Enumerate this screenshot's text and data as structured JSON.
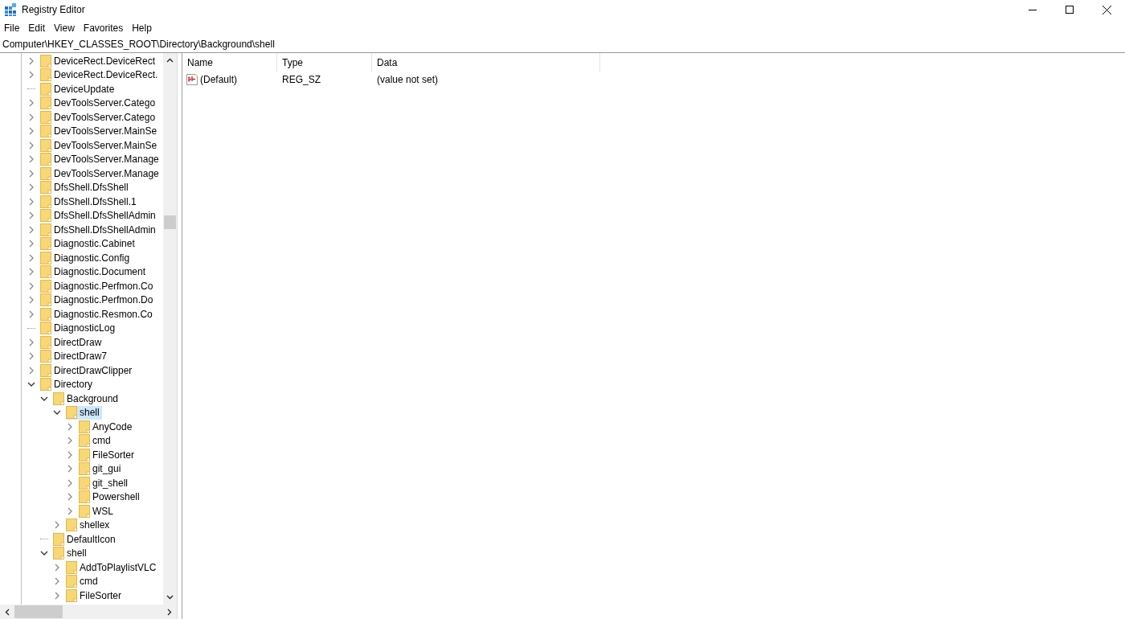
{
  "window": {
    "title": "Registry Editor"
  },
  "menu": [
    "File",
    "Edit",
    "View",
    "Favorites",
    "Help"
  ],
  "address": "Computer\\HKEY_CLASSES_ROOT\\Directory\\Background\\shell",
  "tree": [
    {
      "label": "DeviceRect.DeviceRect",
      "expandable": true,
      "expanded": false,
      "selected": false
    },
    {
      "label": "DeviceRect.DeviceRect.",
      "expandable": true,
      "expanded": false,
      "selected": false
    },
    {
      "label": "DeviceUpdate",
      "expandable": false,
      "selected": false
    },
    {
      "label": "DevToolsServer.Catego",
      "expandable": true,
      "expanded": false,
      "selected": false
    },
    {
      "label": "DevToolsServer.Catego",
      "expandable": true,
      "expanded": false,
      "selected": false
    },
    {
      "label": "DevToolsServer.MainSe",
      "expandable": true,
      "expanded": false,
      "selected": false
    },
    {
      "label": "DevToolsServer.MainSe",
      "expandable": true,
      "expanded": false,
      "selected": false
    },
    {
      "label": "DevToolsServer.Manage",
      "expandable": true,
      "expanded": false,
      "selected": false
    },
    {
      "label": "DevToolsServer.Manage",
      "expandable": true,
      "expanded": false,
      "selected": false
    },
    {
      "label": "DfsShell.DfsShell",
      "expandable": true,
      "expanded": false,
      "selected": false
    },
    {
      "label": "DfsShell.DfsShell.1",
      "expandable": true,
      "expanded": false,
      "selected": false
    },
    {
      "label": "DfsShell.DfsShellAdmin",
      "expandable": true,
      "expanded": false,
      "selected": false
    },
    {
      "label": "DfsShell.DfsShellAdmin",
      "expandable": true,
      "expanded": false,
      "selected": false
    },
    {
      "label": "Diagnostic.Cabinet",
      "expandable": true,
      "expanded": false,
      "selected": false
    },
    {
      "label": "Diagnostic.Config",
      "expandable": true,
      "expanded": false,
      "selected": false
    },
    {
      "label": "Diagnostic.Document",
      "expandable": true,
      "expanded": false,
      "selected": false
    },
    {
      "label": "Diagnostic.Perfmon.Co",
      "expandable": true,
      "expanded": false,
      "selected": false
    },
    {
      "label": "Diagnostic.Perfmon.Do",
      "expandable": true,
      "expanded": false,
      "selected": false
    },
    {
      "label": "Diagnostic.Resmon.Co",
      "expandable": true,
      "expanded": false,
      "selected": false
    },
    {
      "label": "DiagnosticLog",
      "expandable": false,
      "selected": false
    },
    {
      "label": "DirectDraw",
      "expandable": true,
      "expanded": false,
      "selected": false
    },
    {
      "label": "DirectDraw7",
      "expandable": true,
      "expanded": false,
      "selected": false
    },
    {
      "label": "DirectDrawClipper",
      "expandable": true,
      "expanded": false,
      "selected": false
    },
    {
      "label": "Directory",
      "expandable": true,
      "expanded": true,
      "selected": false,
      "children": [
        {
          "label": "Background",
          "expandable": true,
          "expanded": true,
          "selected": false,
          "children": [
            {
              "label": "shell",
              "expandable": true,
              "expanded": true,
              "selected": true,
              "children": [
                {
                  "label": "AnyCode",
                  "expandable": true,
                  "expanded": false,
                  "selected": false
                },
                {
                  "label": "cmd",
                  "expandable": true,
                  "expanded": false,
                  "selected": false
                },
                {
                  "label": "FileSorter",
                  "expandable": true,
                  "expanded": false,
                  "selected": false
                },
                {
                  "label": "git_gui",
                  "expandable": true,
                  "expanded": false,
                  "selected": false
                },
                {
                  "label": "git_shell",
                  "expandable": true,
                  "expanded": false,
                  "selected": false
                },
                {
                  "label": "Powershell",
                  "expandable": true,
                  "expanded": false,
                  "selected": false
                },
                {
                  "label": "WSL",
                  "expandable": true,
                  "expanded": false,
                  "selected": false
                }
              ]
            },
            {
              "label": "shellex",
              "expandable": true,
              "expanded": false,
              "selected": false
            }
          ]
        },
        {
          "label": "DefaultIcon",
          "expandable": false,
          "selected": false
        },
        {
          "label": "shell",
          "expandable": true,
          "expanded": true,
          "selected": false,
          "children": [
            {
              "label": "AddToPlaylistVLC",
              "expandable": true,
              "expanded": false,
              "selected": false
            },
            {
              "label": "cmd",
              "expandable": true,
              "expanded": false,
              "selected": false
            },
            {
              "label": "FileSorter",
              "expandable": true,
              "expanded": false,
              "selected": false
            }
          ]
        }
      ]
    }
  ],
  "columns": [
    "Name",
    "Type",
    "Data"
  ],
  "values": [
    {
      "name": "(Default)",
      "type": "REG_SZ",
      "data": "(value not set)",
      "kind": "string"
    }
  ]
}
